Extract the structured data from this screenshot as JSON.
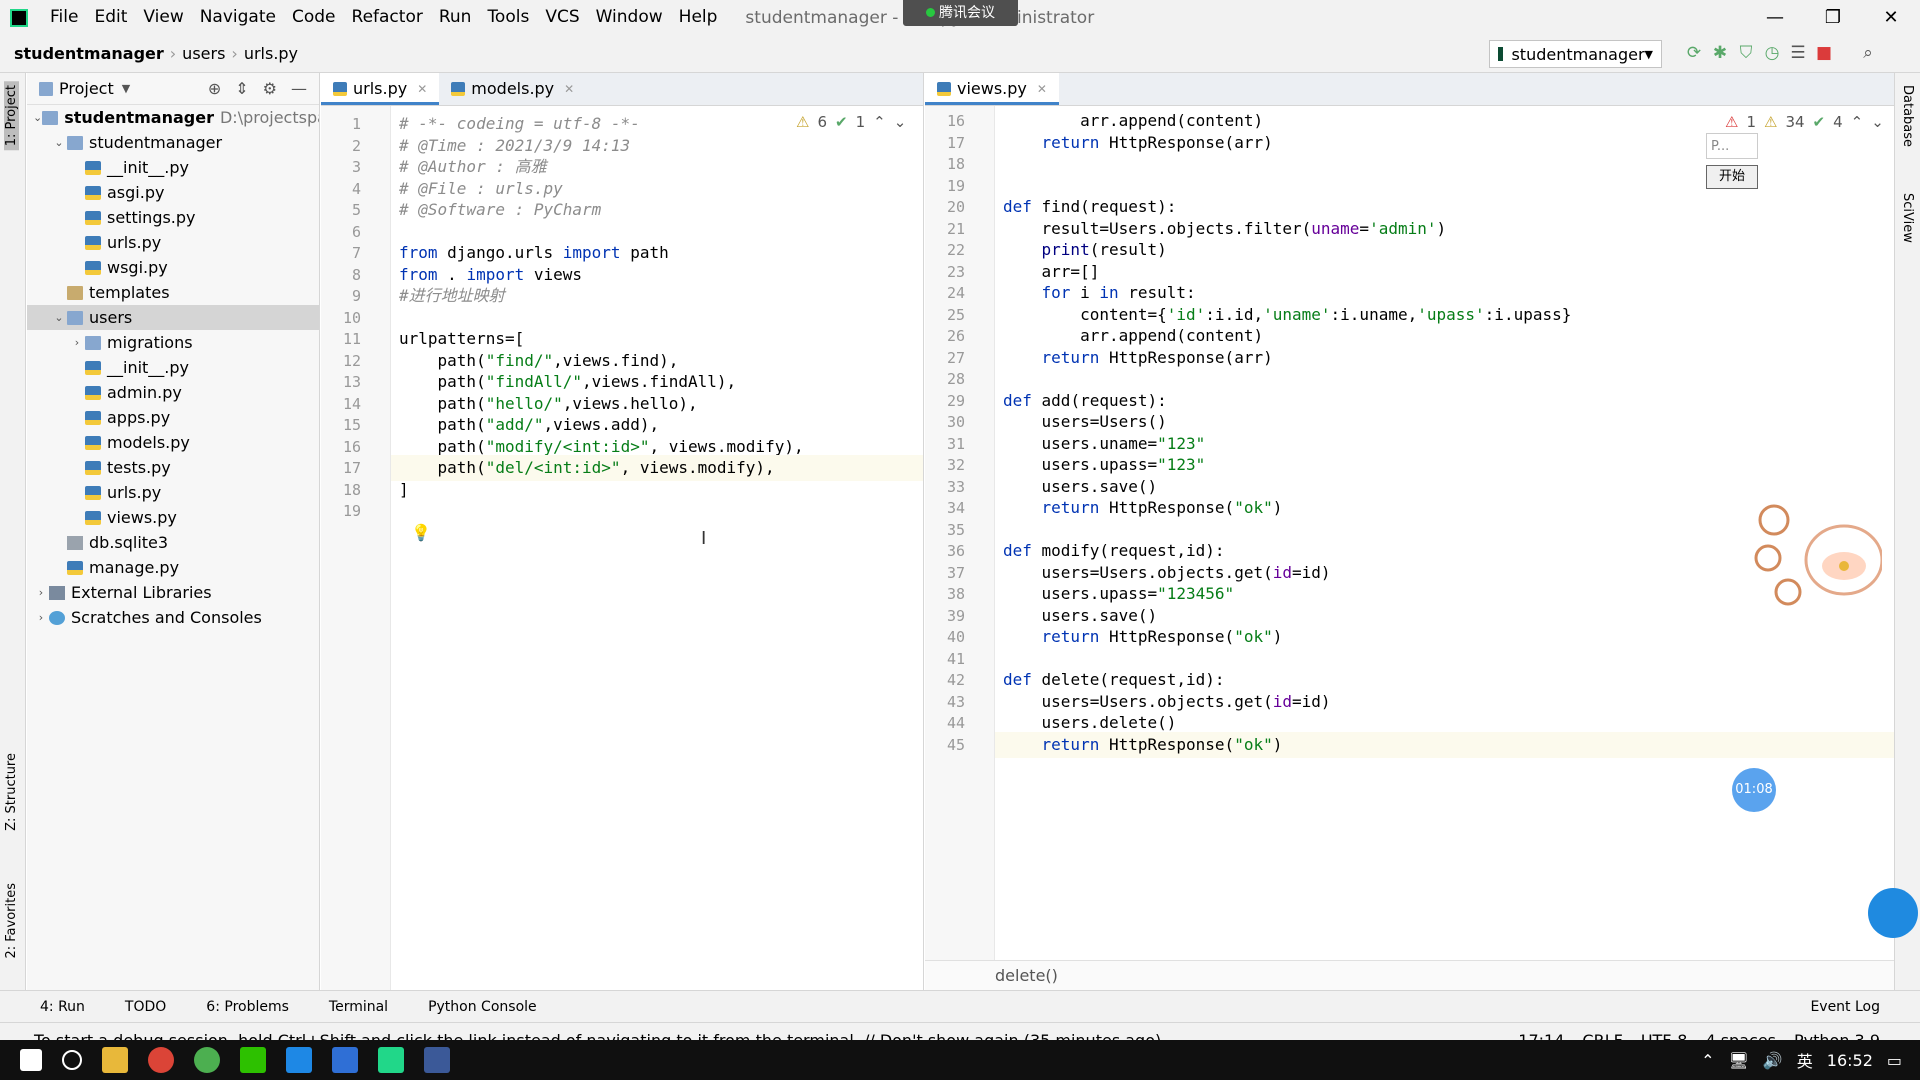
{
  "window": {
    "title": "studentmanager - urls.py - Administrator",
    "meeting_badge": "腾讯会议",
    "minimize": "—",
    "maximize": "❐",
    "close": "✕"
  },
  "menu": [
    "File",
    "Edit",
    "View",
    "Navigate",
    "Code",
    "Refactor",
    "Run",
    "Tools",
    "VCS",
    "Window",
    "Help"
  ],
  "breadcrumb": [
    "studentmanager",
    "users",
    "urls.py"
  ],
  "run_config": "studentmanager",
  "left_tabs": [
    "1: Project",
    "Z: Structure",
    "2: Favorites"
  ],
  "right_tabs": [
    "Database",
    "SciView"
  ],
  "project": {
    "header": "Project",
    "root_path": "D:\\projectspac",
    "tree": [
      {
        "label": "studentmanager",
        "type": "folder",
        "depth": 0,
        "expanded": true,
        "bold": true
      },
      {
        "label": "studentmanager",
        "type": "folder",
        "depth": 1,
        "expanded": true
      },
      {
        "label": "__init__.py",
        "type": "py",
        "depth": 2
      },
      {
        "label": "asgi.py",
        "type": "py",
        "depth": 2
      },
      {
        "label": "settings.py",
        "type": "py",
        "depth": 2
      },
      {
        "label": "urls.py",
        "type": "py",
        "depth": 2
      },
      {
        "label": "wsgi.py",
        "type": "py",
        "depth": 2
      },
      {
        "label": "templates",
        "type": "plainfolder",
        "depth": 1
      },
      {
        "label": "users",
        "type": "folder",
        "depth": 1,
        "expanded": true,
        "selected": true
      },
      {
        "label": "migrations",
        "type": "folder",
        "depth": 2,
        "collapsed": true
      },
      {
        "label": "__init__.py",
        "type": "py",
        "depth": 2
      },
      {
        "label": "admin.py",
        "type": "py",
        "depth": 2
      },
      {
        "label": "apps.py",
        "type": "py",
        "depth": 2
      },
      {
        "label": "models.py",
        "type": "py",
        "depth": 2
      },
      {
        "label": "tests.py",
        "type": "py",
        "depth": 2
      },
      {
        "label": "urls.py",
        "type": "py",
        "depth": 2
      },
      {
        "label": "views.py",
        "type": "py",
        "depth": 2
      },
      {
        "label": "db.sqlite3",
        "type": "db",
        "depth": 1
      },
      {
        "label": "manage.py",
        "type": "py",
        "depth": 1
      },
      {
        "label": "External Libraries",
        "type": "lib",
        "depth": 0,
        "collapsed": true
      },
      {
        "label": "Scratches and Consoles",
        "type": "scr",
        "depth": 0,
        "collapsed": true
      }
    ]
  },
  "left_editor": {
    "tabs": [
      {
        "label": "urls.py",
        "active": true
      },
      {
        "label": "models.py",
        "active": false
      }
    ],
    "inspect": {
      "warnings": "6",
      "ok": "1"
    },
    "current_line": 17,
    "lines": [
      {
        "n": "1",
        "html": "<span class='cm'># -*- codeing = utf-8 -*-</span>"
      },
      {
        "n": "2",
        "html": "<span class='cm'># @Time : 2021/3/9 14:13</span>"
      },
      {
        "n": "3",
        "html": "<span class='cm'># @Author : 高雅</span>"
      },
      {
        "n": "4",
        "html": "<span class='cm'># @File : urls.py</span>"
      },
      {
        "n": "5",
        "html": "<span class='cm'># @Software : PyCharm</span>"
      },
      {
        "n": "6",
        "html": ""
      },
      {
        "n": "7",
        "html": "<span class='kw'>from</span> django.urls <span class='kw'>import</span> path"
      },
      {
        "n": "8",
        "html": "<span class='kw'>from</span> . <span class='kw'>import</span> views"
      },
      {
        "n": "9",
        "html": "<span class='cm'>#进行地址映射</span>"
      },
      {
        "n": "10",
        "html": ""
      },
      {
        "n": "11",
        "html": "urlpatterns=["
      },
      {
        "n": "12",
        "html": "    path(<span class='str'>\"find/\"</span>,views.find),"
      },
      {
        "n": "13",
        "html": "    path(<span class='str'>\"findAll/\"</span>,views.findAll),"
      },
      {
        "n": "14",
        "html": "    path(<span class='str'>\"hello/\"</span>,views.hello),"
      },
      {
        "n": "15",
        "html": "    path(<span class='str'>\"add/\"</span>,views.add),"
      },
      {
        "n": "16",
        "html": "    path(<span class='str'>\"modify/&lt;int:id&gt;\"</span>, views.modify),"
      },
      {
        "n": "17",
        "html": "    path(<span class='str'>\"del/&lt;int:id&gt;\"</span>, views.modify),"
      },
      {
        "n": "18",
        "html": "]"
      },
      {
        "n": "19",
        "html": ""
      }
    ]
  },
  "right_editor": {
    "tabs": [
      {
        "label": "views.py",
        "active": true
      }
    ],
    "inspect": {
      "errors": "1",
      "warnings": "34",
      "ok": "4"
    },
    "current_line": 45,
    "footer": "delete()",
    "lines": [
      {
        "n": "16",
        "html": "        arr.append(content)"
      },
      {
        "n": "17",
        "html": "    <span class='kw'>return</span> HttpResponse(arr)"
      },
      {
        "n": "18",
        "html": ""
      },
      {
        "n": "19",
        "html": ""
      },
      {
        "n": "20",
        "html": "<span class='kw'>def</span> find(request):"
      },
      {
        "n": "21",
        "html": "    result=Users.objects.filter(<span class='pr'>uname</span>=<span class='str'>'admin'</span>)"
      },
      {
        "n": "22",
        "html": "    <span class='bi'>print</span>(result)"
      },
      {
        "n": "23",
        "html": "    arr=[]"
      },
      {
        "n": "24",
        "html": "    <span class='kw'>for</span> i <span class='kw'>in</span> result:"
      },
      {
        "n": "25",
        "html": "        content={<span class='str'>'id'</span>:i.id,<span class='str'>'uname'</span>:i.uname,<span class='str'>'upass'</span>:i.upass}"
      },
      {
        "n": "26",
        "html": "        arr.append(content)"
      },
      {
        "n": "27",
        "html": "    <span class='kw'>return</span> HttpResponse(arr)"
      },
      {
        "n": "28",
        "html": ""
      },
      {
        "n": "29",
        "html": "<span class='kw'>def</span> add(request):"
      },
      {
        "n": "30",
        "html": "    users=Users()"
      },
      {
        "n": "31",
        "html": "    users.uname=<span class='str'>\"123\"</span>"
      },
      {
        "n": "32",
        "html": "    users.upass=<span class='str'>\"123\"</span>"
      },
      {
        "n": "33",
        "html": "    users.save()"
      },
      {
        "n": "34",
        "html": "    <span class='kw'>return</span> HttpResponse(<span class='str'>\"ok\"</span>)"
      },
      {
        "n": "35",
        "html": ""
      },
      {
        "n": "36",
        "html": "<span class='kw'>def</span> modify(request,id):"
      },
      {
        "n": "37",
        "html": "    users=Users.objects.get(<span class='pr'>id</span>=id)"
      },
      {
        "n": "38",
        "html": "    users.upass=<span class='str'>\"123456\"</span>"
      },
      {
        "n": "39",
        "html": "    users.save()"
      },
      {
        "n": "40",
        "html": "    <span class='kw'>return</span> HttpResponse(<span class='str'>\"ok\"</span>)"
      },
      {
        "n": "41",
        "html": ""
      },
      {
        "n": "42",
        "html": "<span class='kw'>def</span> delete(request,id):"
      },
      {
        "n": "43",
        "html": "    users=Users.objects.get(<span class='pr'>id</span>=id)"
      },
      {
        "n": "44",
        "html": "    users.delete()"
      },
      {
        "n": "45",
        "html": "    <span class='kw'>return</span> HttpResponse(<span class='str'>\"ok\"</span>)"
      }
    ]
  },
  "overlay": {
    "mini_placeholder": "P...",
    "mini_button": "开始",
    "timer": "01:08"
  },
  "tool_windows": [
    "4: Run",
    "TODO",
    "6: Problems",
    "Terminal",
    "Python Console"
  ],
  "event_log": "Event Log",
  "status": {
    "message": "To start a debug session, hold Ctrl+Shift and click the link instead of navigating to it from the terminal. // Don't show again (35 minutes ago)",
    "position": "17:14",
    "line_sep": "CRLF",
    "encoding": "UTF-8",
    "indent": "4 spaces",
    "interpreter": "Python 3.9"
  },
  "taskbar": {
    "ime": "英",
    "clock": "16:52"
  }
}
